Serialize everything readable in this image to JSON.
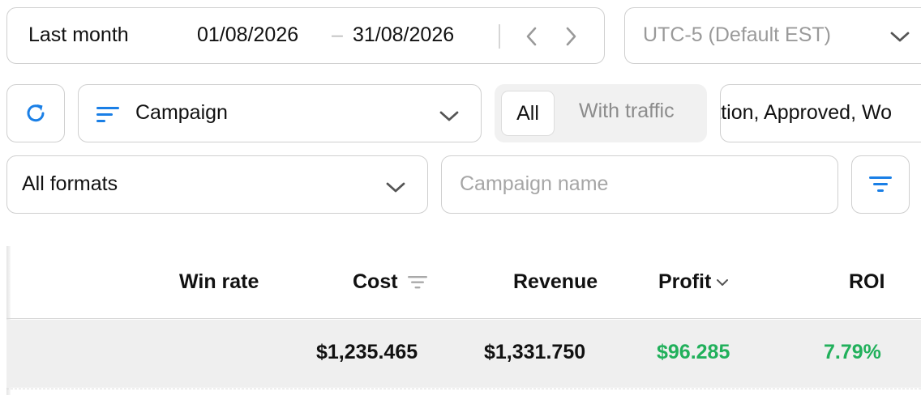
{
  "date_range": {
    "preset": "Last month",
    "from": "01/08/2026",
    "separator": "–",
    "to": "31/08/2026"
  },
  "timezone": {
    "label": "UTC-5 (Default EST)"
  },
  "group_by": {
    "label": "Campaign"
  },
  "traffic_filter": {
    "options": [
      "All",
      "With traffic"
    ],
    "selected": "All"
  },
  "status_filter": {
    "value": "ration, Approved, Wo"
  },
  "formats": {
    "label": "All formats"
  },
  "search": {
    "placeholder": "Campaign name",
    "value": ""
  },
  "table": {
    "columns": [
      {
        "label": "Win rate"
      },
      {
        "label": "Cost",
        "filter": true
      },
      {
        "label": "Revenue"
      },
      {
        "label": "Profit",
        "sort": "desc"
      },
      {
        "label": "ROI"
      }
    ],
    "summary": {
      "win_rate": "",
      "cost": "$1,235.465",
      "revenue": "$1,331.750",
      "profit": "$96.285",
      "roi": "7.79%"
    }
  },
  "colors": {
    "accent": "#1a7fe6",
    "positive": "#21b05b",
    "border": "#cfcfcf"
  },
  "icons": {
    "refresh": "refresh-icon",
    "sort_lines": "sort-lines-icon",
    "filter": "filter-icon",
    "chevron_down": "chevron-down-icon",
    "chevron_left": "chevron-left-icon",
    "chevron_right": "chevron-right-icon"
  }
}
